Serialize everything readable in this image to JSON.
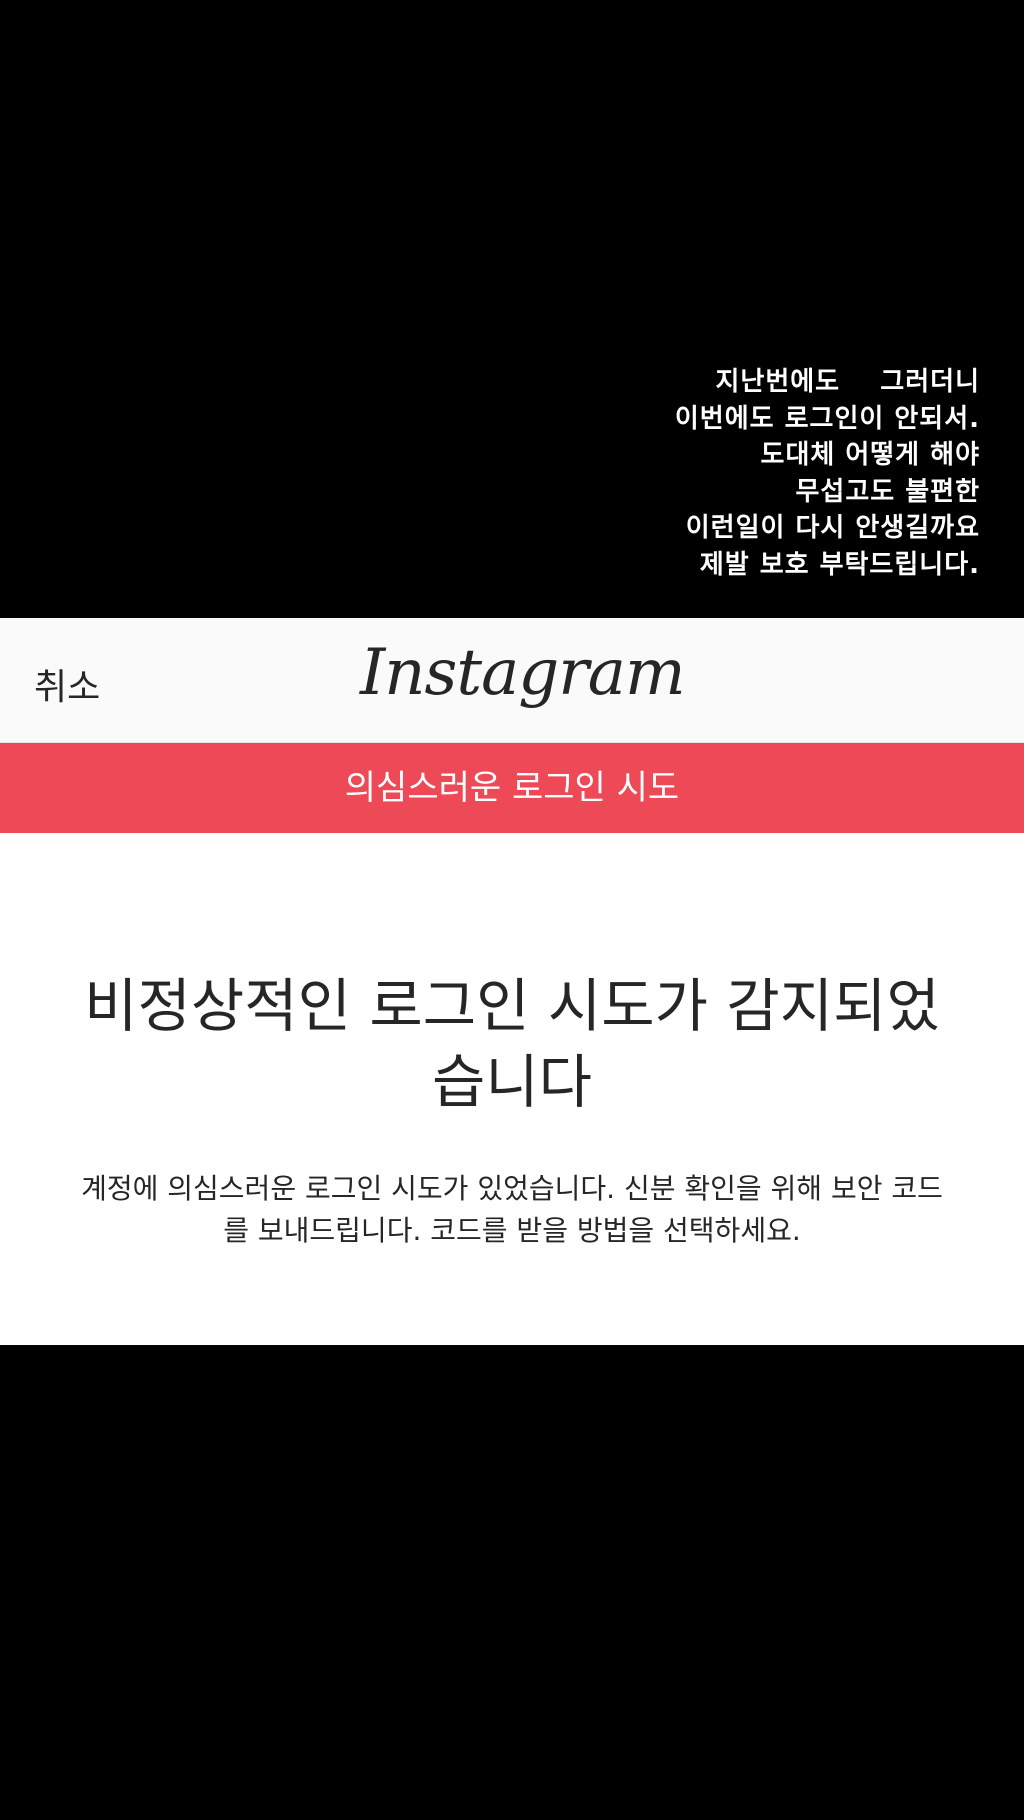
{
  "caption": {
    "lines": [
      "지난번에도    그러더니",
      "이번에도 로그인이 안되서.",
      "도대체 어떻게 해야",
      "무섭고도 불편한",
      "이런일이 다시 안생길까요",
      "제발 보호 부탁드립니다."
    ]
  },
  "header": {
    "cancel_label": "취소",
    "logo_text": "Instagram"
  },
  "alert": {
    "banner_text": "의심스러운 로그인 시도"
  },
  "main": {
    "headline": "비정상적인 로그인 시도가 감지되었습니다",
    "description": "계정에 의심스러운 로그인 시도가 있었습니다. 신분 확인을 위해 보안 코드를 보내드립니다. 코드를 받을 방법을 선택하세요."
  },
  "colors": {
    "alert_red": "#ed4956",
    "header_bg": "#fafafa",
    "text_dark": "#262626",
    "background": "#000000"
  }
}
